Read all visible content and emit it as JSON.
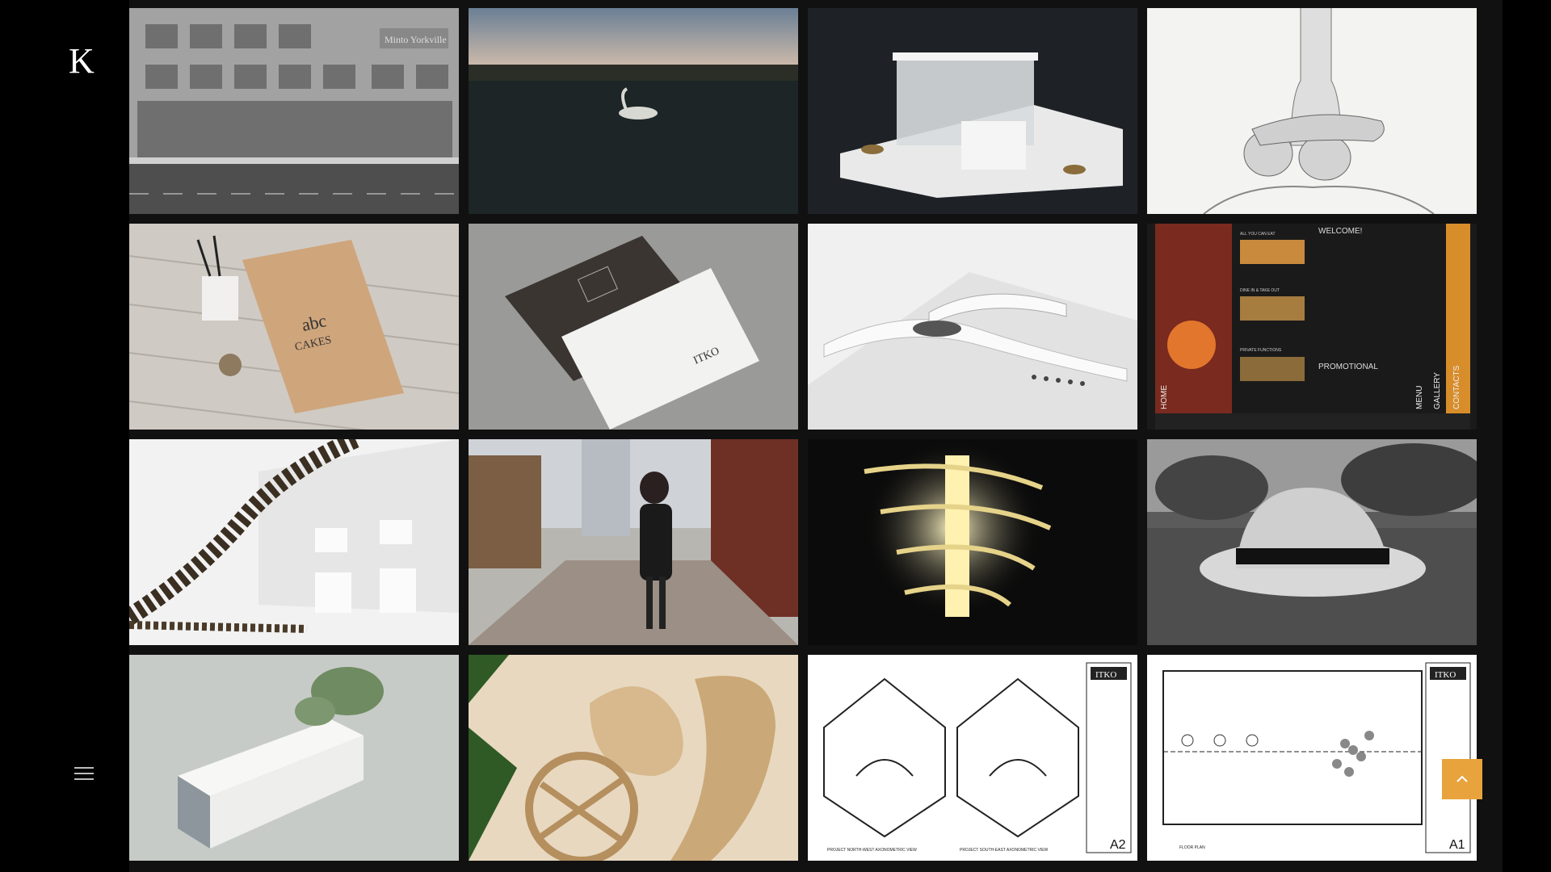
{
  "logo": {
    "mark": "K"
  },
  "menu": {
    "icon": "hamburger-icon"
  },
  "to_top": {
    "icon": "chevron-up-icon",
    "color": "#e8a33d"
  },
  "tiles": [
    {
      "name": "street-building-photo",
      "texts": {
        "sign": "Minto Yorkville"
      }
    },
    {
      "name": "swan-lake-photo"
    },
    {
      "name": "house-model-photo"
    },
    {
      "name": "pencil-still-life-sketch"
    },
    {
      "name": "abc-cakes-branding-photo",
      "texts": {
        "bag_line1": "abc",
        "bag_line2": "CAKES"
      }
    },
    {
      "name": "itko-business-card-photo",
      "texts": {
        "brand": "ITKO"
      }
    },
    {
      "name": "white-architecture-model-photo"
    },
    {
      "name": "sushi-website-layout",
      "texts": {
        "welcome": "WELCOME!",
        "promo": "PROMOTIONAL",
        "h1": "ALL YOU CAN EAT",
        "h2": "DINE IN & TAKE OUT",
        "h3": "PRIVATE FUNCTIONS",
        "home": "HOME",
        "menu": "MENU",
        "gallery": "GALLERY",
        "contacts": "CONTACTS"
      }
    },
    {
      "name": "sculpture-model-photo"
    },
    {
      "name": "woman-street-photo"
    },
    {
      "name": "glowing-lamp-photo"
    },
    {
      "name": "hat-on-grass-photo"
    },
    {
      "name": "building-rendering"
    },
    {
      "name": "wood-model-photo"
    },
    {
      "name": "axonometric-drawing-a2",
      "texts": {
        "brand": "ITKO",
        "sheet": "A2",
        "view1": "PROJECT NORTH-WEST AXONOMETRIC VIEW",
        "view2": "PROJECT SOUTH-EAST AXONOMETRIC VIEW"
      }
    },
    {
      "name": "floor-plan-drawing-a1",
      "texts": {
        "brand": "ITKO",
        "sheet": "A1",
        "view": "FLOOR PLAN"
      }
    }
  ]
}
